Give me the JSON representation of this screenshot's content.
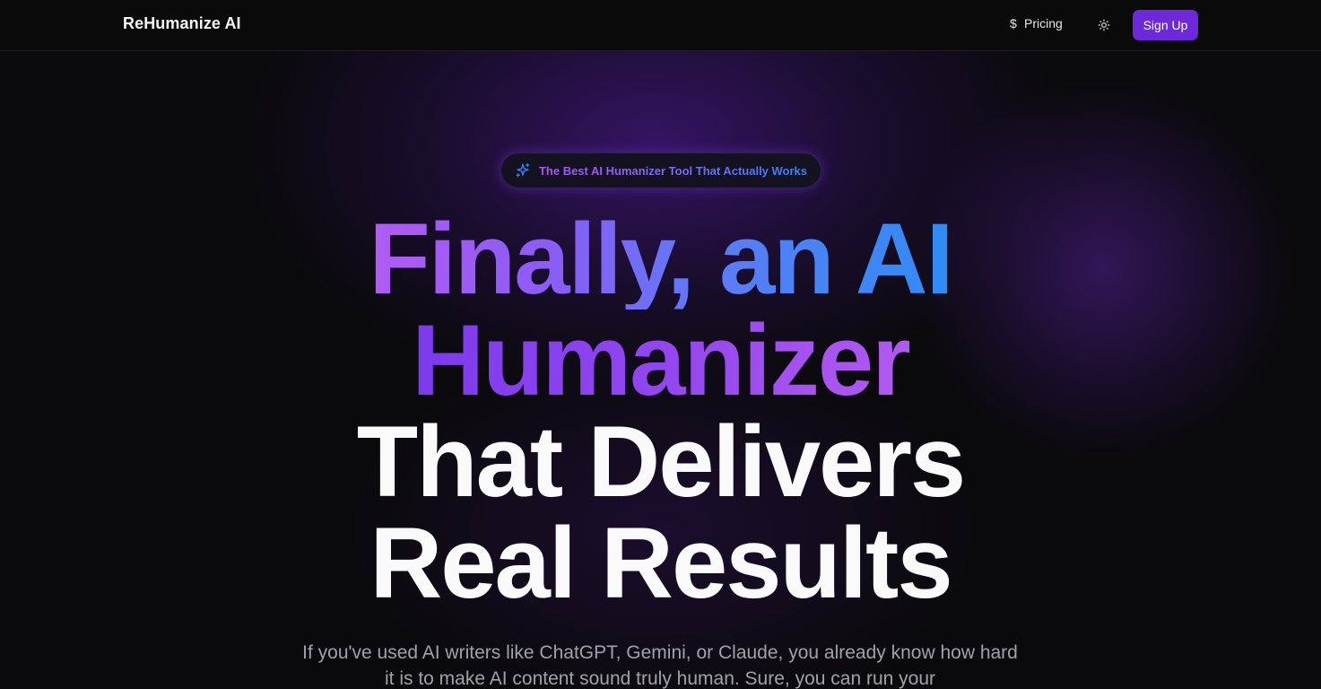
{
  "header": {
    "logo": "ReHumanize AI",
    "nav": {
      "pricing_label": "Pricing",
      "pricing_icon": "dollar-icon",
      "theme_icon": "sun-icon"
    },
    "signup_label": "Sign Up"
  },
  "hero": {
    "badge_icon": "sparkles-icon",
    "badge_text": "The Best AI Humanizer Tool That Actually Works",
    "headline": {
      "line1": "Finally, an AI",
      "line2": "Humanizer",
      "line3": "That Delivers",
      "line4": "Real Results"
    },
    "description": "If you've used AI writers like ChatGPT, Gemini, or Claude, you already know how hard it is to make AI content sound truly human. Sure, you can run your"
  },
  "colors": {
    "brand_purple": "#6d28d9",
    "gradient_start": "#a855f7",
    "gradient_end": "#3b82f6",
    "background": "#0a0a0c"
  }
}
